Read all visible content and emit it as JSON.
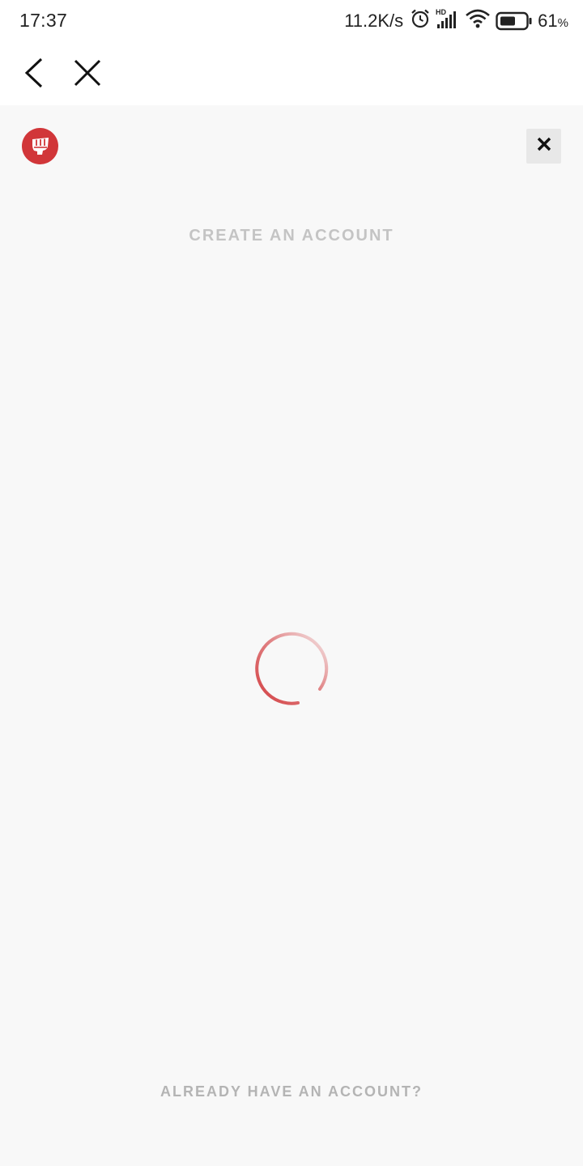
{
  "status_bar": {
    "time": "17:37",
    "network_speed": "11.2K/s",
    "battery_level": "61",
    "battery_unit": "%",
    "icons": [
      "alarm-icon",
      "hd-signal-icon",
      "wifi-icon",
      "battery-icon"
    ]
  },
  "nav": {
    "icons": [
      "back-arrow-icon",
      "close-icon"
    ]
  },
  "dialog": {
    "heading": "CREATE AN ACCOUNT",
    "login_link": "ALREADY HAVE AN ACCOUNT?",
    "icons": [
      "riot-fist-logo-icon",
      "close-icon",
      "loading-spinner-icon"
    ]
  },
  "colors": {
    "brand_red": "#d13639",
    "background": "#f8f8f8",
    "muted_text": "#c4c4c4"
  }
}
